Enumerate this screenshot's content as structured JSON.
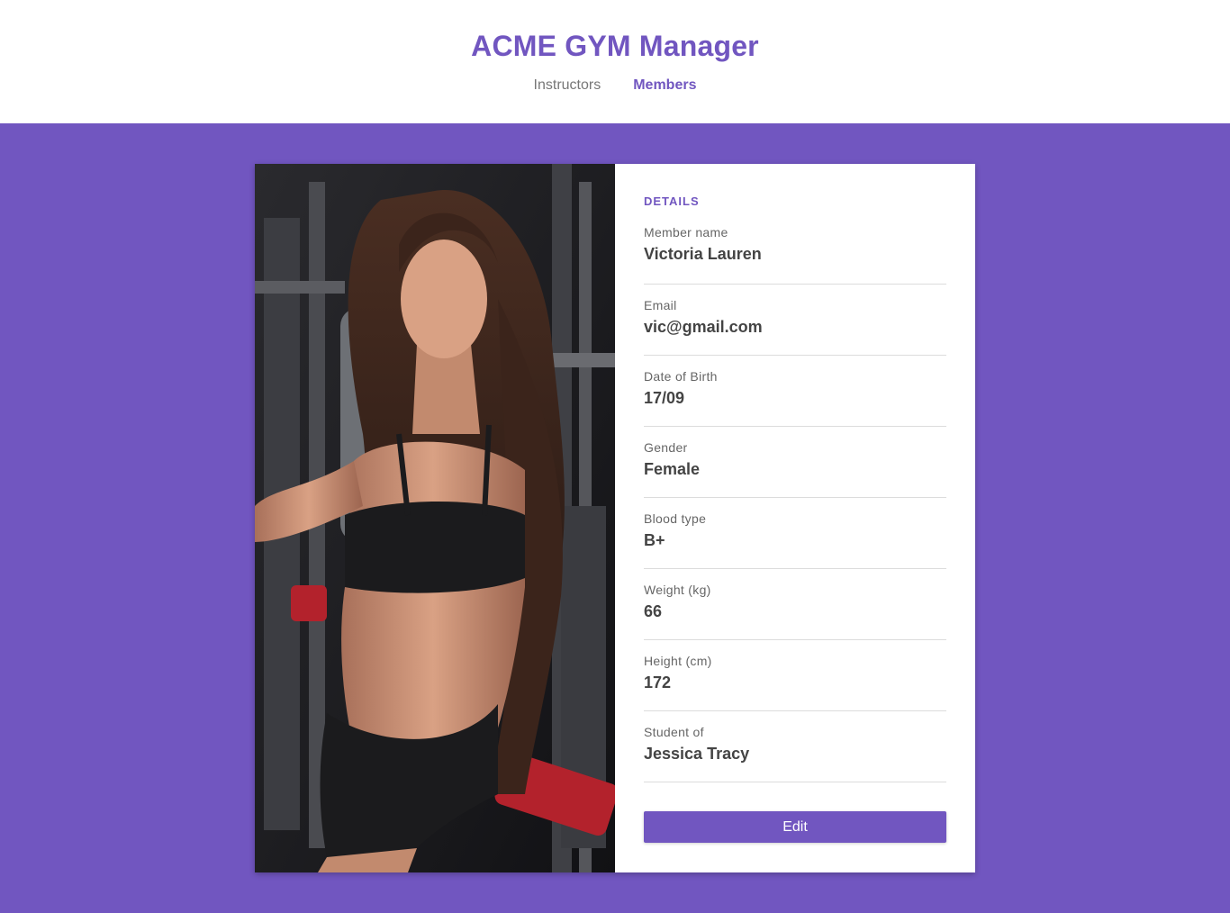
{
  "header": {
    "title": "ACME GYM Manager",
    "nav": [
      {
        "label": "Instructors",
        "active": false
      },
      {
        "label": "Members",
        "active": true
      }
    ]
  },
  "colors": {
    "accent": "#7156c0",
    "background": "#7156c0",
    "card": "#ffffff"
  },
  "member": {
    "photo_alt": "member-photo",
    "section_title": "DETAILS",
    "fields": [
      {
        "label": "Member name",
        "value": "Victoria Lauren"
      },
      {
        "label": "Email",
        "value": "vic@gmail.com"
      },
      {
        "label": "Date of Birth",
        "value": "17/09"
      },
      {
        "label": "Gender",
        "value": "Female"
      },
      {
        "label": "Blood type",
        "value": "B+"
      },
      {
        "label": "Weight (kg)",
        "value": "66"
      },
      {
        "label": "Height (cm)",
        "value": "172"
      },
      {
        "label": "Student of",
        "value": "Jessica Tracy"
      }
    ],
    "edit_label": "Edit"
  }
}
